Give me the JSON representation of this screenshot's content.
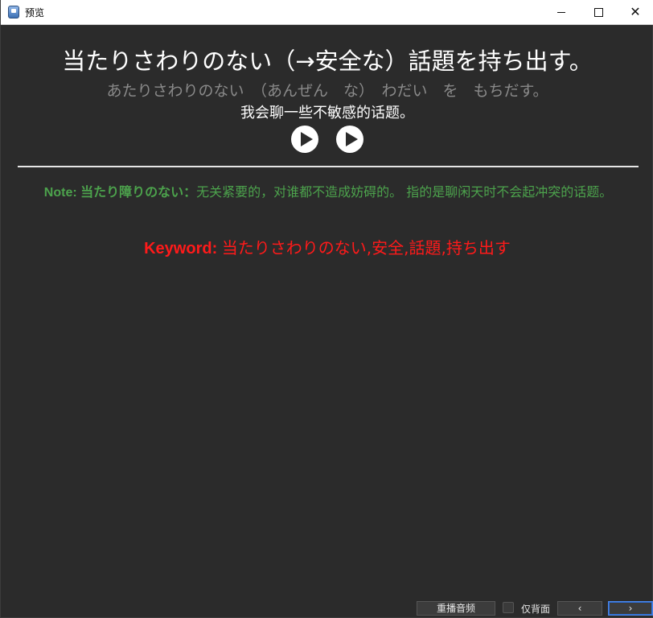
{
  "window": {
    "title": "预览",
    "icons": {
      "app": "app-icon",
      "minimize": "minimize-icon",
      "maximize": "maximize-icon",
      "close": "close-icon"
    }
  },
  "card": {
    "headline": "当たりさわりのない（→安全な）話題を持ち出す。",
    "reading": "あたりさわりのない　（あんぜん　な）　わだい　を　もちだす。",
    "translation": "我会聊一些不敏感的话题。",
    "note_label": "Note: 当たり障りのない：",
    "note_text": "无关紧要的，对谁都不造成妨碍的。 指的是聊闲天时不会起冲突的话题。",
    "keyword_label": "Keyword: ",
    "keyword_text": "当たりさわりのない,安全,話題,持ち出す"
  },
  "controls": {
    "replay_label": "重播音频",
    "back_only_label": "仅背面",
    "back_only_checked": false,
    "prev_label": "‹",
    "next_label": "›"
  },
  "colors": {
    "background": "#2b2b2b",
    "note": "#4ca24c",
    "keyword": "#ff1a1a",
    "reading": "#8a8a8a"
  }
}
